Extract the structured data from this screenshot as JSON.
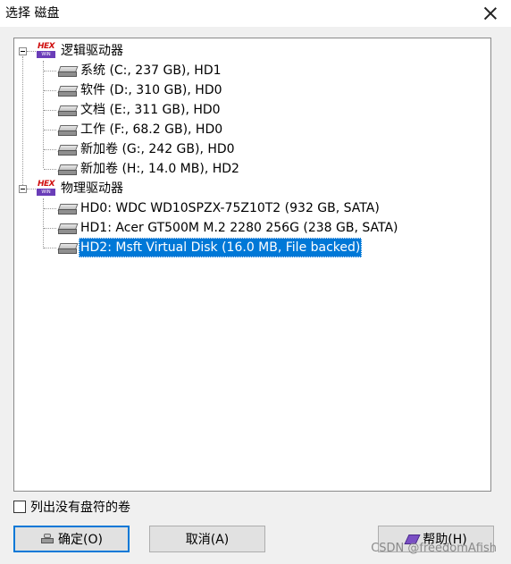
{
  "window": {
    "title": "选择 磁盘"
  },
  "tree": {
    "groups": [
      {
        "label": "逻辑驱动器",
        "icon": "hex-logical-drives-icon",
        "items": [
          "系统 (C:, 237 GB), HD1",
          "软件 (D:, 310 GB), HD0",
          "文档 (E:, 311 GB), HD0",
          "工作 (F:, 68.2 GB), HD0",
          "新加卷 (G:, 242 GB), HD0",
          "新加卷 (H:, 14.0 MB), HD2"
        ]
      },
      {
        "label": "物理驱动器",
        "icon": "hex-physical-drives-icon",
        "items": [
          "HD0: WDC WD10SPZX-75Z10T2 (932 GB, SATA)",
          "HD1: Acer GT500M M.2 2280 256G (238 GB, SATA)",
          "HD2: Msft Virtual Disk (16.0 MB, File backed)"
        ]
      }
    ],
    "selected": "HD2: Msft Virtual Disk (16.0 MB, File backed)",
    "hex_top": "HEX",
    "hex_bottom": "WIN"
  },
  "options": {
    "list_no_letter_volumes": "列出没有盘符的卷",
    "checked": false
  },
  "buttons": {
    "ok": "确定(O)",
    "cancel": "取消(A)",
    "help": "帮助(H)"
  },
  "watermark": "CSDN @freedomAfish",
  "colors": {
    "selection": "#0078d7",
    "hex_icon_purple": "#6a3db8",
    "hex_icon_red": "#d01010"
  }
}
